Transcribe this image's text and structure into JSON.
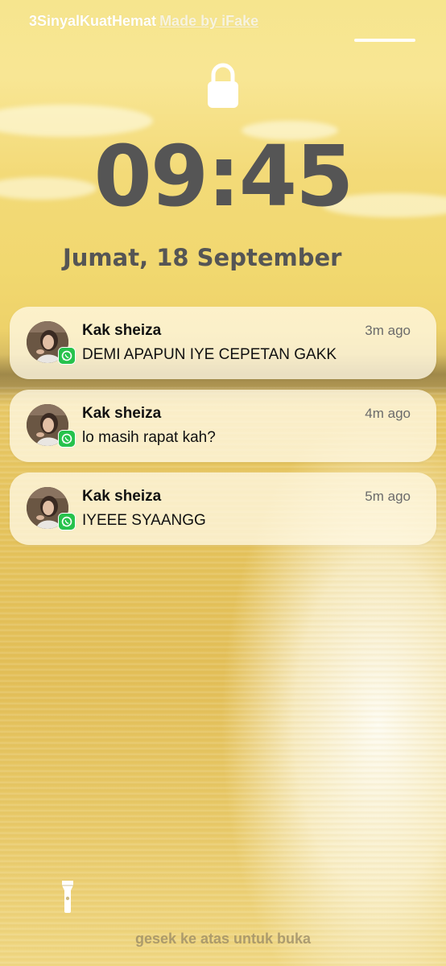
{
  "status_bar": {
    "carrier": "3SinyalKuatHemat",
    "watermark": "Made by iFake"
  },
  "lockscreen": {
    "time": "09:45",
    "date": "Jumat, 18 September",
    "unlock_hint": "gesek ke atas untuk buka"
  },
  "notifications": [
    {
      "app": "whatsapp",
      "sender": "Kak sheiza",
      "time": "3m ago",
      "message": "DEMI APAPUN IYE CEPETAN GAKK"
    },
    {
      "app": "whatsapp",
      "sender": "Kak sheiza",
      "time": "4m ago",
      "message": "lo masih rapat kah?"
    },
    {
      "app": "whatsapp",
      "sender": "Kak sheiza",
      "time": "5m ago",
      "message": "IYEEE SYAANGG"
    }
  ],
  "icons": {
    "lock": "lock-icon",
    "flashlight": "flashlight-icon",
    "app_badge": "whatsapp-icon"
  },
  "colors": {
    "clock_text": "#555555",
    "whatsapp_green": "#27c24c",
    "notification_bg": "#fff8e4"
  }
}
